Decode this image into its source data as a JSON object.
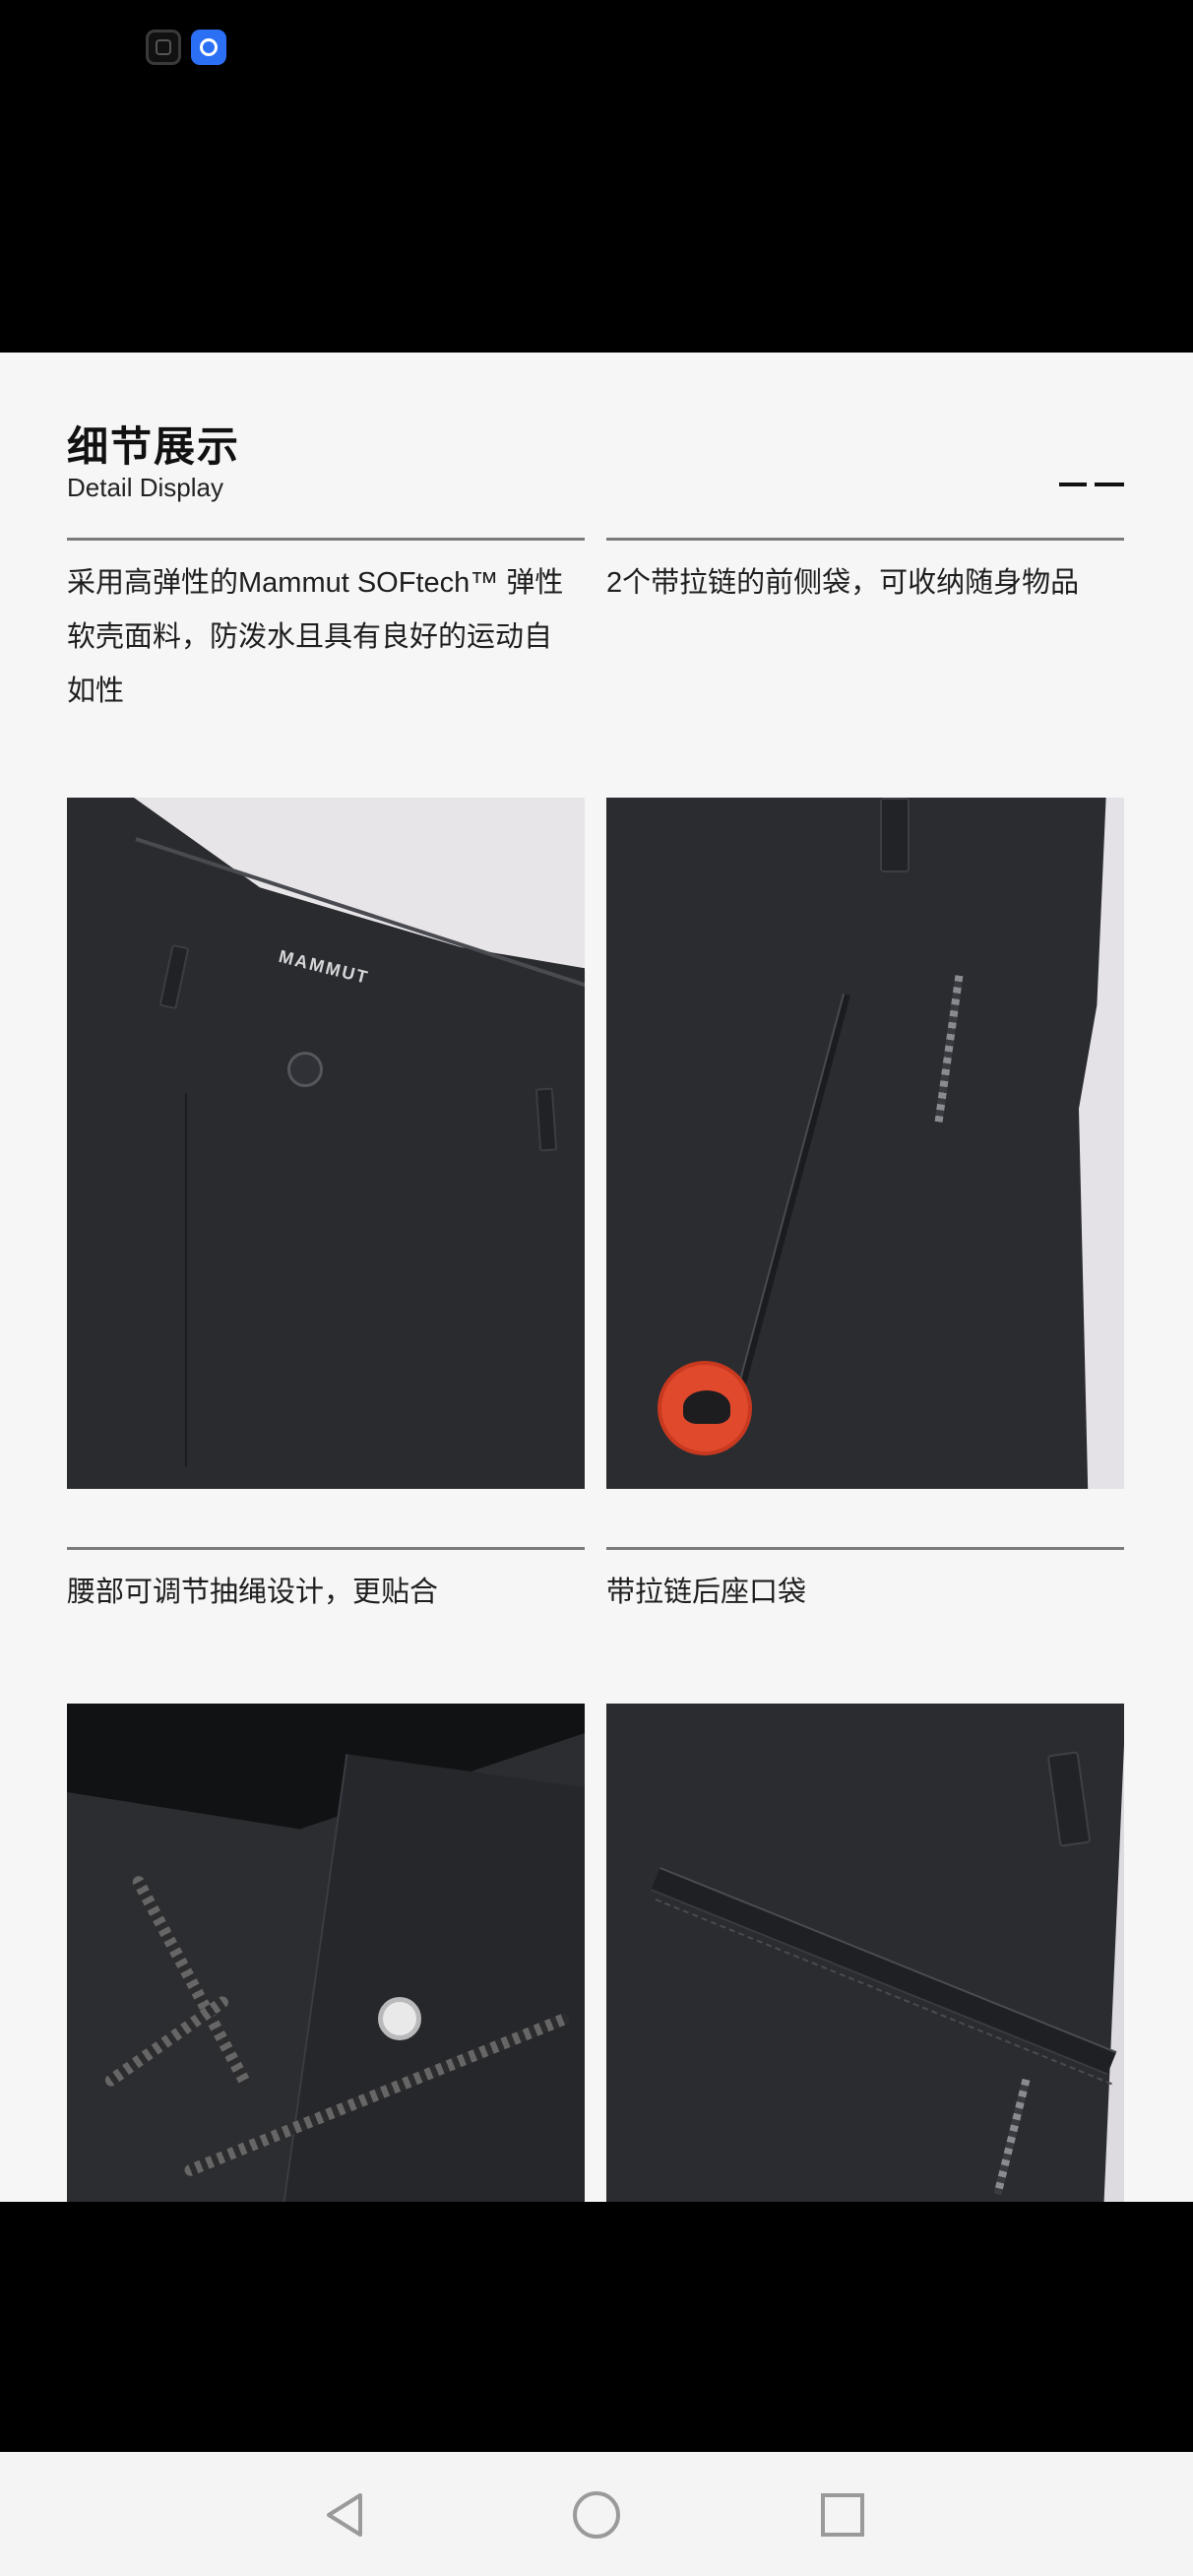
{
  "status_bar": {
    "icons": [
      "app-icon-dark",
      "app-icon-blue"
    ]
  },
  "section": {
    "title_cn": "细节展示",
    "title_en": "Detail Display"
  },
  "features": [
    {
      "caption": "采用高弹性的Mammut SOFtech™ 弹性软壳面料，防泼水且具有良好的运动自如性",
      "image": "waistband-front-photo",
      "label_on_garment": "MAMMUT"
    },
    {
      "caption": "2个带拉链的前侧袋，可收纳随身物品",
      "image": "side-zip-pocket-photo"
    },
    {
      "caption": "腰部可调节抽绳设计，更贴合",
      "image": "drawcord-waist-photo"
    },
    {
      "caption": "带拉链后座口袋",
      "image": "back-zip-pocket-photo"
    }
  ],
  "nav_bar": {
    "buttons": [
      "back",
      "home",
      "recent-apps"
    ]
  },
  "colors": {
    "sheet_background": "#f6f6f6",
    "text": "#1e1e1e",
    "rule": "#7a7a7a",
    "garment": "#2b2c30",
    "logo_red": "#e0492c"
  }
}
